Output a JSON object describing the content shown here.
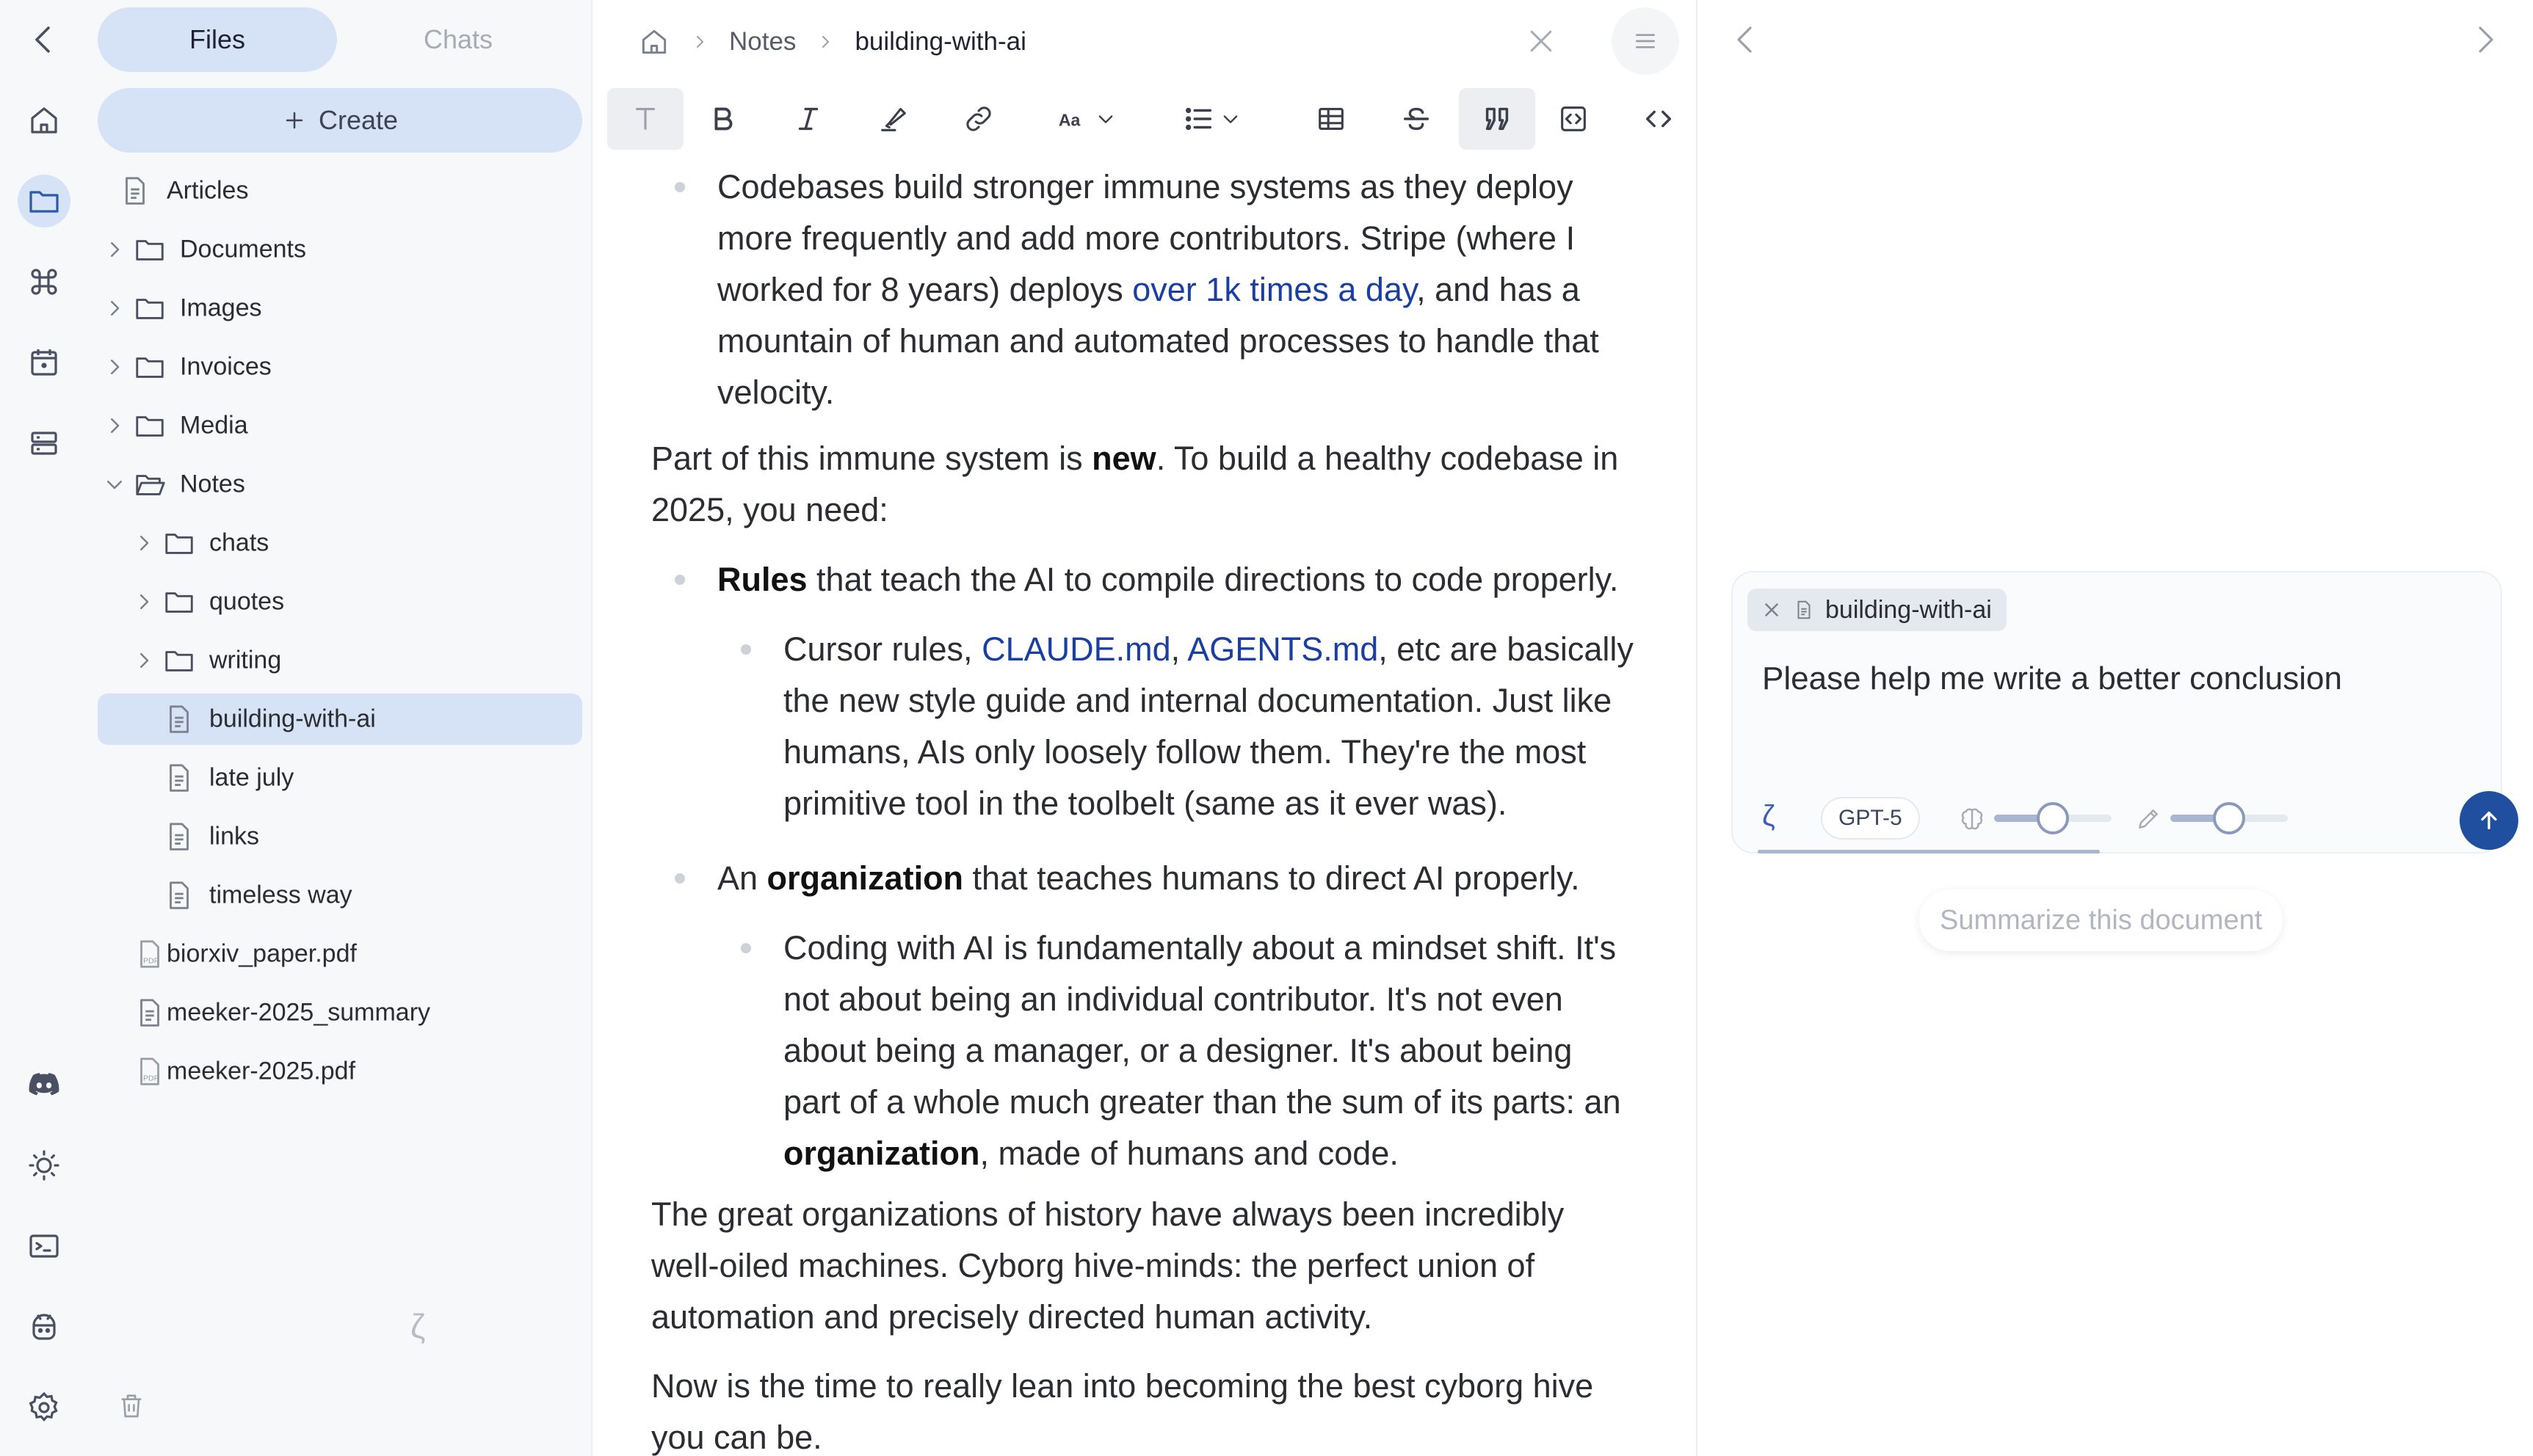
{
  "sidebar": {
    "tabs": [
      "Files",
      "Chats"
    ],
    "active_tab": "Files",
    "create_label": "Create",
    "tree": [
      {
        "label": "Articles",
        "type": "doc",
        "depth": 0
      },
      {
        "label": "Documents",
        "type": "folder",
        "depth": 0,
        "expanded": false
      },
      {
        "label": "Images",
        "type": "folder",
        "depth": 0,
        "expanded": false
      },
      {
        "label": "Invoices",
        "type": "folder",
        "depth": 0,
        "expanded": false
      },
      {
        "label": "Media",
        "type": "folder",
        "depth": 0,
        "expanded": false
      },
      {
        "label": "Notes",
        "type": "folder",
        "depth": 0,
        "expanded": true
      },
      {
        "label": "chats",
        "type": "folder",
        "depth": 1,
        "expanded": false
      },
      {
        "label": "quotes",
        "type": "folder",
        "depth": 1,
        "expanded": false
      },
      {
        "label": "writing",
        "type": "folder",
        "depth": 1,
        "expanded": false
      },
      {
        "label": "building-with-ai",
        "type": "doc",
        "depth": 1,
        "selected": true
      },
      {
        "label": "late july",
        "type": "doc",
        "depth": 1
      },
      {
        "label": "links",
        "type": "doc",
        "depth": 1
      },
      {
        "label": "timeless way",
        "type": "doc",
        "depth": 1
      },
      {
        "label": "biorxiv_paper.pdf",
        "type": "pdf",
        "depth": 0
      },
      {
        "label": "meeker-2025_summary",
        "type": "doc",
        "depth": 0
      },
      {
        "label": "meeker-2025.pdf",
        "type": "pdf",
        "depth": 0
      }
    ],
    "spinner_glyph": "ζ"
  },
  "rail": {
    "top_icons": [
      "back-icon",
      "home-icon",
      "folder-icon",
      "command-icon",
      "calendar-icon",
      "storage-icon"
    ],
    "bottom_icons": [
      "discord-icon",
      "sun-icon",
      "terminal-icon",
      "bot-icon",
      "settings-icon"
    ]
  },
  "editor": {
    "breadcrumbs": [
      "Notes",
      "building-with-ai"
    ],
    "toolbar": [
      "text",
      "bold",
      "italic",
      "highlight",
      "link",
      "font-size",
      "list",
      "table",
      "strikethrough",
      "quote",
      "code-block",
      "code"
    ],
    "text": {
      "b1_l1": "Codebases build stronger immune systems as they deploy",
      "b1_l2": "more frequently and add more contributors. Stripe (where I",
      "b1_l3_pre": "worked for 8 years) deploys ",
      "b1_l3_link": "over 1k times a day",
      "b1_l3_post": ", and has a",
      "b1_l4": "mountain of human and automated processes to handle that",
      "b1_l5": "velocity.",
      "p1_l1_pre": "Part of this immune system is ",
      "p1_l1_bold": "new",
      "p1_l1_post": ". To build a healthy codebase in",
      "p1_l2": "2025, you need:",
      "b2_bold": "Rules",
      "b2_rest": " that teach the AI to compile directions to code properly.",
      "b3_l1_pre": "Cursor rules, ",
      "b3_l1_link1": "CLAUDE.md",
      "b3_l1_mid": ", ",
      "b3_l1_link2": "AGENTS.md",
      "b3_l1_post": ", etc are basically",
      "b3_l2": "the new style guide and internal documentation. Just like",
      "b3_l3": "humans, AIs only loosely follow them. They're the most",
      "b3_l4": "primitive tool in the toolbelt (same as it ever was).",
      "b4_pre": "An ",
      "b4_bold": "organization",
      "b4_post": " that teaches humans to direct AI properly.",
      "b5_l1": "Coding with AI is fundamentally about a mindset shift. It's",
      "b5_l2": "not about being an individual contributor. It's not even",
      "b5_l3": "about being a manager, or a designer. It's about being",
      "b5_l4": "part of a whole much greater than the sum of its parts: an",
      "b5_l5_bold": "organization",
      "b5_l5_post": ", made of humans and code.",
      "p2_l1": "The great organizations of history have always been incredibly",
      "p2_l2": "well-oiled machines. Cyborg hive-minds: the perfect union of",
      "p2_l3": "automation and precisely directed human activity.",
      "p3_l1": "Now is the time to really lean into becoming the best cyborg hive",
      "p3_l2": "you can be."
    }
  },
  "chat": {
    "context_chip": "building-with-ai",
    "prompt": "Please help me write a better conclusion",
    "mode_glyph": "ζ",
    "model": "GPT-5",
    "reasoning_level": 0.5,
    "creativity_level": 0.5,
    "suggestion": "Summarize this document"
  },
  "colors": {
    "accent": "#1f4f9e",
    "selection": "#d6e2f5",
    "link": "#1b3fa0"
  }
}
